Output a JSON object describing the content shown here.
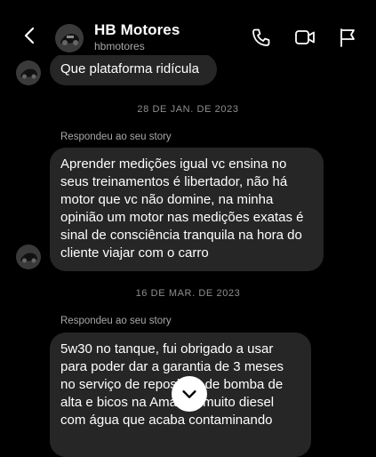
{
  "header": {
    "title": "HB Motores",
    "subtitle": "hbmotores",
    "icons": [
      "back-icon",
      "phone-icon",
      "video-icon",
      "flag-icon"
    ]
  },
  "messages": {
    "msg1": "Que plataforma ridícula",
    "date1": "28 DE JAN. DE 2023",
    "reply1": "Respondeu ao seu story",
    "msg2": "Aprender medições igual vc ensina no seus treinamentos é libertador, não há motor que vc não domine, na minha opinião um motor nas medições exatas é sinal de consciência tranquila na hora do cliente viajar com o carro",
    "date2": "16 DE MAR. DE 2023",
    "reply2": "Respondeu ao seu story",
    "msg3": "5w30 no tanque, fui obrigado a usar para poder dar a garantia de 3 meses no serviço de reposição de bomba de alta e bicos na Amarok, muito diesel com água que acaba contaminando"
  },
  "colors": {
    "background": "#000000",
    "bubble": "#262626",
    "secondary_text": "#a8a8a8"
  }
}
